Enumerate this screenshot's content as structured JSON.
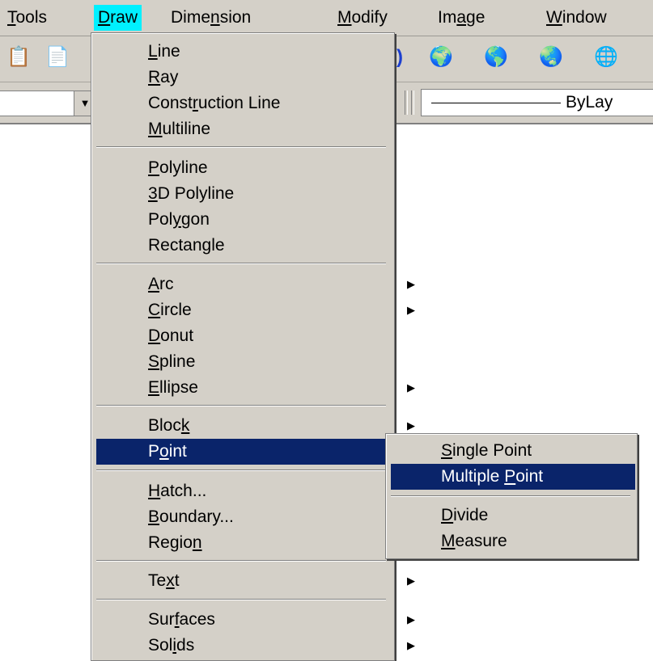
{
  "menubar": {
    "items": [
      {
        "label": "Tools",
        "mn": "T",
        "rest": "ools",
        "active": false
      },
      {
        "label": "Draw",
        "mn": "D",
        "rest": "raw",
        "active": true
      },
      {
        "label": "Dimension",
        "pre": "Dime",
        "mn": "n",
        "post": "sion",
        "active": false
      },
      {
        "label": "Modify",
        "mn": "M",
        "rest": "odify",
        "active": false
      },
      {
        "label": "Image",
        "pre": "Im",
        "mn": "a",
        "post": "ge",
        "active": false
      },
      {
        "label": "Window",
        "mn": "W",
        "rest": "indow",
        "active": false
      }
    ]
  },
  "toolbar": {
    "icons": [
      "paste-icon",
      "clipboard-icon",
      "help-icon",
      "globe-icon",
      "globe-icon",
      "globe-icon",
      "globe-icon"
    ],
    "linetype_value": "ByLay"
  },
  "draw_menu": {
    "line": {
      "mn": "L",
      "rest": "ine"
    },
    "ray": {
      "mn": "R",
      "rest": "ay"
    },
    "construction_line": {
      "pre": "Const",
      "mn": "r",
      "post": "uction Line"
    },
    "multiline": {
      "mn": "M",
      "rest": "ultiline"
    },
    "polyline": {
      "mn": "P",
      "rest": "olyline"
    },
    "polyline3d": {
      "mn": "3",
      "rest": "D Polyline"
    },
    "polygon": {
      "pre": "Pol",
      "mn": "y",
      "post": "gon"
    },
    "rectangle": {
      "pre": "Rectan",
      "mn": "g",
      "post": "le"
    },
    "arc": {
      "mn": "A",
      "rest": "rc"
    },
    "circle": {
      "mn": "C",
      "rest": "ircle"
    },
    "donut": {
      "mn": "D",
      "rest": "onut"
    },
    "spline": {
      "mn": "S",
      "rest": "pline"
    },
    "ellipse": {
      "mn": "E",
      "rest": "llipse"
    },
    "block": {
      "pre": "Bloc",
      "mn": "k",
      "post": ""
    },
    "point": {
      "pre": "P",
      "mn": "o",
      "post": "int"
    },
    "hatch": {
      "mn": "H",
      "rest": "atch..."
    },
    "boundary": {
      "mn": "B",
      "rest": "oundary..."
    },
    "region": {
      "pre": "Regio",
      "mn": "n",
      "post": ""
    },
    "text": {
      "pre": "Te",
      "mn": "x",
      "post": "t"
    },
    "surfaces": {
      "pre": "Sur",
      "mn": "f",
      "post": "aces"
    },
    "solids": {
      "pre": "Sol",
      "mn": "i",
      "post": "ds"
    }
  },
  "point_submenu": {
    "single_point": {
      "mn": "S",
      "rest": "ingle Point"
    },
    "multiple_point": {
      "pre": "Multiple ",
      "mn": "P",
      "post": "oint"
    },
    "divide": {
      "mn": "D",
      "rest": "ivide"
    },
    "measure": {
      "mn": "M",
      "rest": "easure"
    }
  },
  "colors": {
    "menu_bg": "#d4d0c8",
    "highlight": "#0a246a",
    "active_menu": "#00f0ff"
  }
}
